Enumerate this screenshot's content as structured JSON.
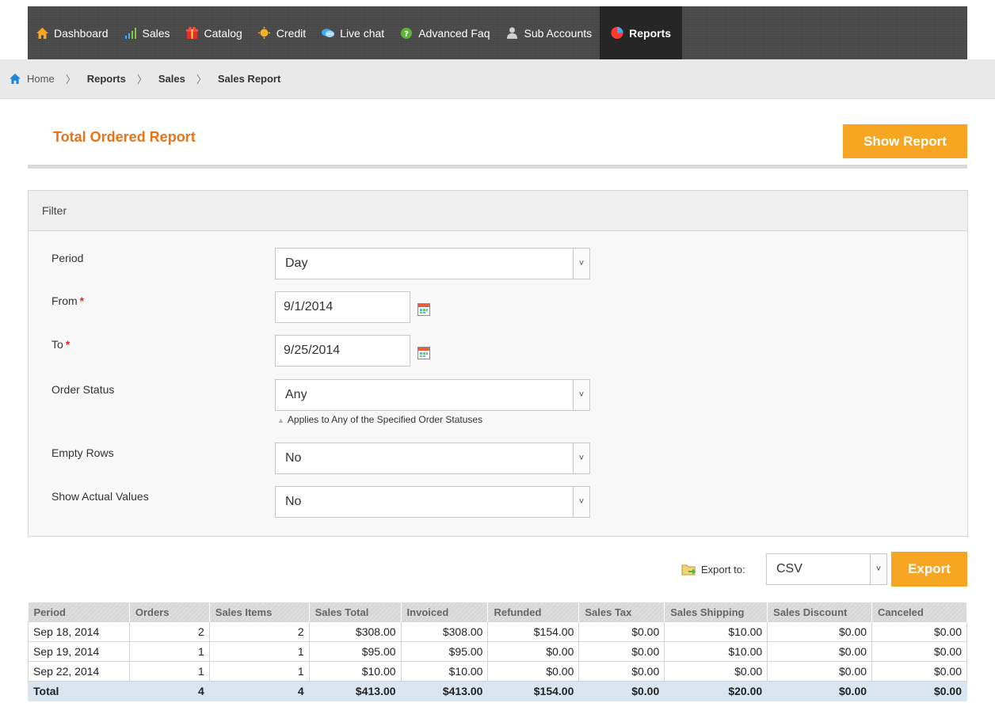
{
  "nav": {
    "items": [
      {
        "label": "Dashboard",
        "icon": "home-icon"
      },
      {
        "label": "Sales",
        "icon": "bar-chart-icon"
      },
      {
        "label": "Catalog",
        "icon": "gift-icon"
      },
      {
        "label": "Credit",
        "icon": "coin-icon"
      },
      {
        "label": "Live chat",
        "icon": "chat-icon"
      },
      {
        "label": "Advanced Faq",
        "icon": "help-icon"
      },
      {
        "label": "Sub Accounts",
        "icon": "user-icon"
      },
      {
        "label": "Reports",
        "icon": "pie-chart-icon"
      }
    ],
    "active_index": 7
  },
  "breadcrumb": {
    "home": "Home",
    "items": [
      "Reports",
      "Sales",
      "Sales Report"
    ]
  },
  "page": {
    "title": "Total Ordered Report",
    "show_report_label": "Show Report"
  },
  "filter": {
    "heading": "Filter",
    "period_label": "Period",
    "period_value": "Day",
    "from_label": "From",
    "from_value": "9/1/2014",
    "to_label": "To",
    "to_value": "9/25/2014",
    "order_status_label": "Order Status",
    "order_status_value": "Any",
    "order_status_hint": "Applies to Any of the Specified Order Statuses",
    "empty_rows_label": "Empty Rows",
    "empty_rows_value": "No",
    "actual_values_label": "Show Actual Values",
    "actual_values_value": "No",
    "required_mark": "*"
  },
  "export": {
    "label": "Export to:",
    "format": "CSV",
    "button": "Export"
  },
  "table": {
    "columns": [
      "Period",
      "Orders",
      "Sales Items",
      "Sales Total",
      "Invoiced",
      "Refunded",
      "Sales Tax",
      "Sales Shipping",
      "Sales Discount",
      "Canceled"
    ],
    "rows": [
      [
        "Sep 18, 2014",
        "2",
        "2",
        "$308.00",
        "$308.00",
        "$154.00",
        "$0.00",
        "$10.00",
        "$0.00",
        "$0.00"
      ],
      [
        "Sep 19, 2014",
        "1",
        "1",
        "$95.00",
        "$95.00",
        "$0.00",
        "$0.00",
        "$10.00",
        "$0.00",
        "$0.00"
      ],
      [
        "Sep 22, 2014",
        "1",
        "1",
        "$10.00",
        "$10.00",
        "$0.00",
        "$0.00",
        "$0.00",
        "$0.00",
        "$0.00"
      ]
    ],
    "total": [
      "Total",
      "4",
      "4",
      "$413.00",
      "$413.00",
      "$154.00",
      "$0.00",
      "$20.00",
      "$0.00",
      "$0.00"
    ]
  },
  "colors": {
    "accent": "#f6a623",
    "title": "#e8741a",
    "nav_bg": "#4a4a4a",
    "total_row": "#d9e6ef"
  }
}
